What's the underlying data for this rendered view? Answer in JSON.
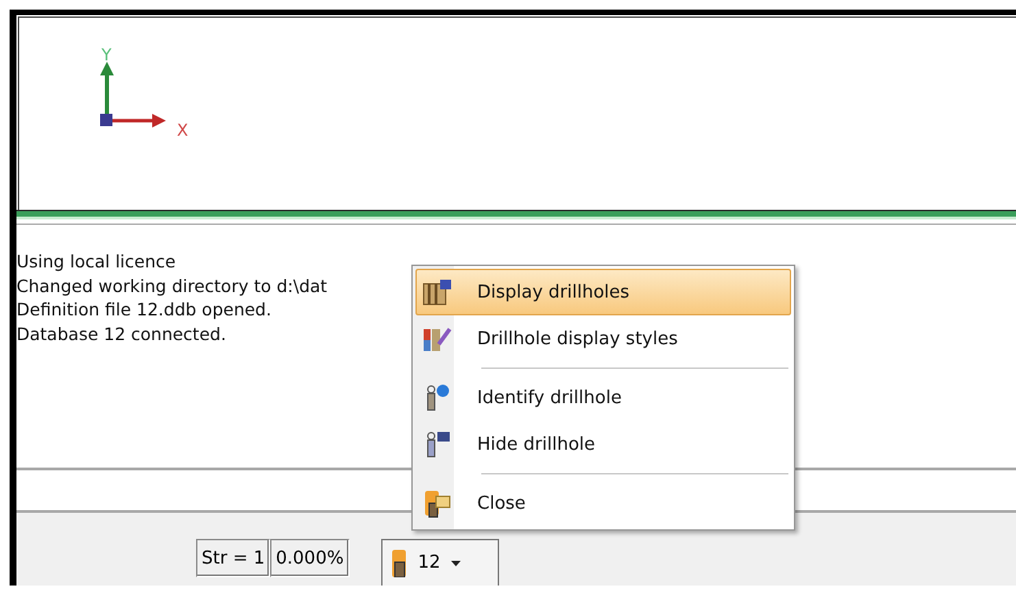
{
  "viewport": {
    "axis_labels": {
      "y": "Y",
      "x": "X"
    }
  },
  "log": {
    "lines": [
      "Using local licence",
      "Changed working directory to d:\\dat",
      "Definition file 12.ddb opened.",
      "Database 12 connected."
    ]
  },
  "status_bar": {
    "string_field": "Str = 1",
    "percent_field": "0.000%",
    "database_button": {
      "label": "12"
    }
  },
  "context_menu": {
    "items": [
      {
        "kind": "item",
        "label": "Display drillholes",
        "selected": true
      },
      {
        "kind": "item",
        "label": "Drillhole display styles",
        "selected": false
      },
      {
        "kind": "separator"
      },
      {
        "kind": "item",
        "label": "Identify drillhole",
        "selected": false
      },
      {
        "kind": "item",
        "label": "Hide drillhole",
        "selected": false
      },
      {
        "kind": "separator"
      },
      {
        "kind": "item",
        "label": "Close",
        "selected": false
      }
    ]
  }
}
